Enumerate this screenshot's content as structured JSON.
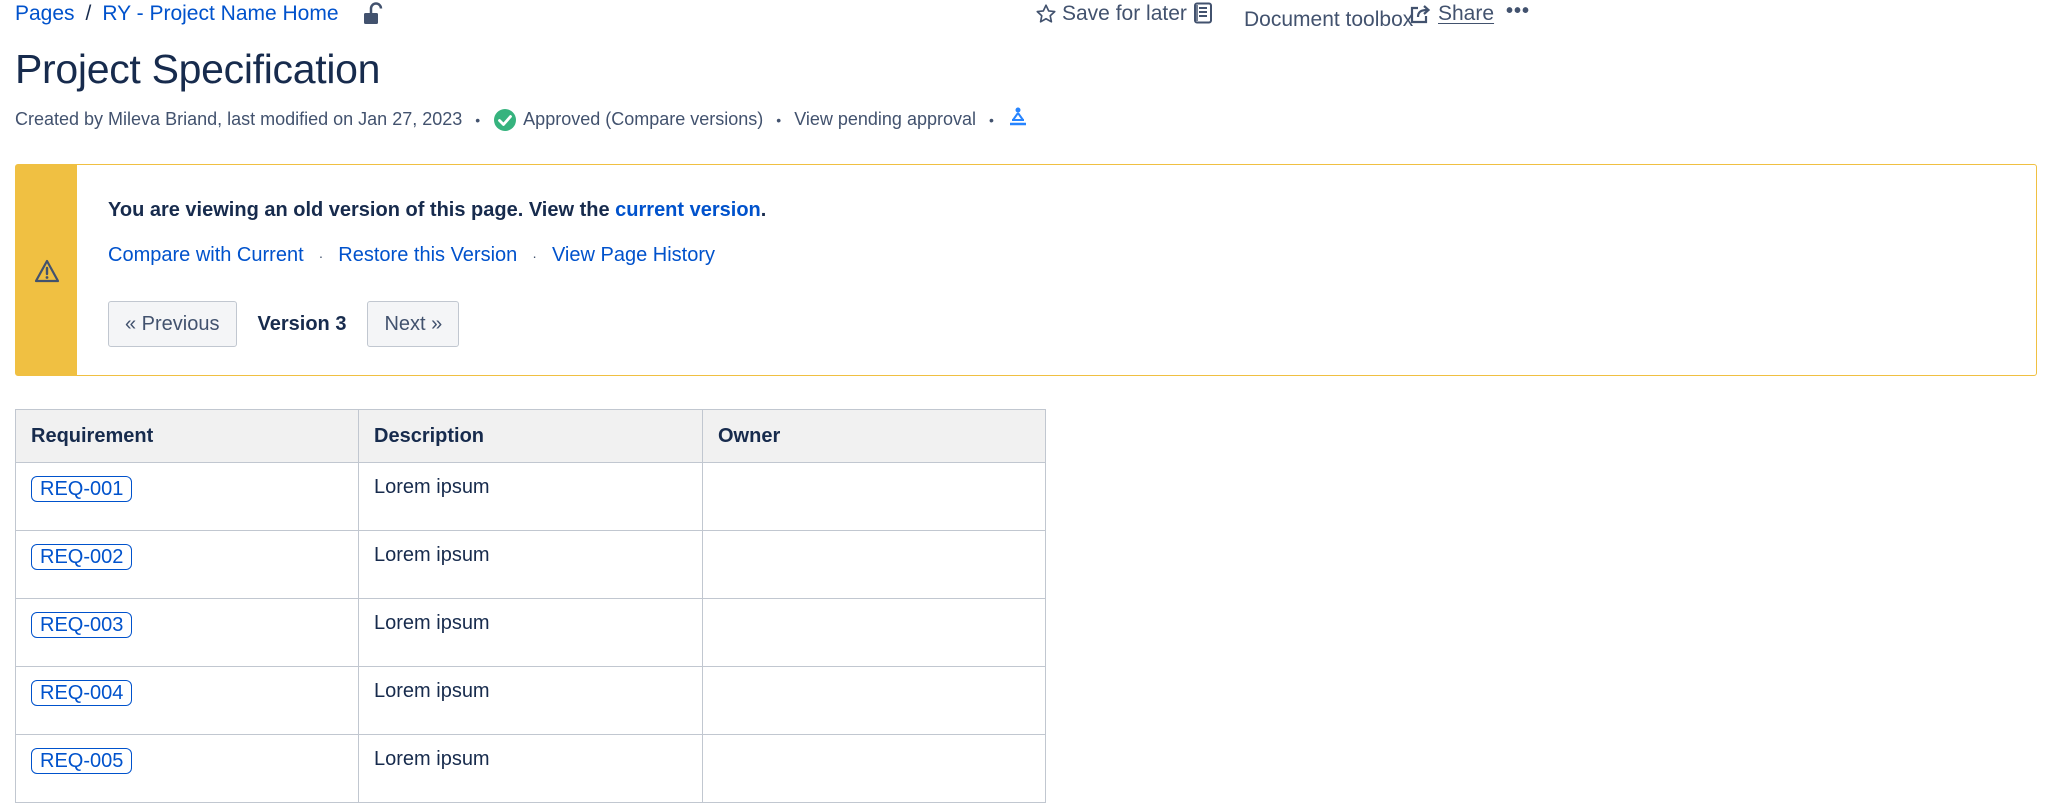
{
  "breadcrumb": {
    "root": "Pages",
    "separator": "/",
    "parent": "RY - Project Name Home"
  },
  "actions": {
    "save_for_later": "Save for later",
    "document_toolbox": "Document toolbox",
    "share": "Share",
    "more": "•••"
  },
  "page": {
    "title": "Project Specification",
    "meta": {
      "created": "Created by Mileva Briand, last modified on Jan 27, 2023",
      "approval": "Approved (Compare versions)",
      "pending": "View pending approval"
    }
  },
  "notice": {
    "message_prefix": "You are viewing an old version of this page. View the ",
    "message_link": "current version",
    "message_suffix": ".",
    "links": {
      "compare": "Compare with Current",
      "restore": "Restore this Version",
      "history": "View Page History"
    },
    "nav": {
      "previous": "« Previous",
      "version": "Version 3",
      "next": "Next »"
    }
  },
  "table": {
    "headers": [
      "Requirement",
      "Description",
      "Owner"
    ],
    "rows": [
      {
        "req": "REQ-001",
        "description": "Lorem ipsum",
        "owner": ""
      },
      {
        "req": "REQ-002",
        "description": "Lorem ipsum",
        "owner": ""
      },
      {
        "req": "REQ-003",
        "description": "Lorem ipsum",
        "owner": ""
      },
      {
        "req": "REQ-004",
        "description": "Lorem ipsum",
        "owner": ""
      },
      {
        "req": "REQ-005",
        "description": "Lorem ipsum",
        "owner": ""
      }
    ]
  },
  "colors": {
    "link": "#0052cc",
    "warning": "#f0c042",
    "approved": "#36b37e",
    "text": "#172b4d"
  }
}
